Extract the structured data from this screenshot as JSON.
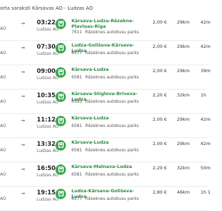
{
  "header": {
    "title": "orta saraksti Kārsavas AO - Ludzas AO"
  },
  "rows": [
    {
      "dep_time": "",
      "dep_stop": "AO",
      "arr_time": "03:22",
      "arr_stop": "Ludzas AO",
      "route": "Kārsava-Ludza-Rēzekne-Pļaviņas-Rīga",
      "route_no": "7611",
      "operator": "Rēzeknes autobusu parks",
      "price": "2,00 €",
      "distance": "29km",
      "duration": "42m"
    },
    {
      "dep_time": "",
      "dep_stop": "AO",
      "arr_time": "07:30",
      "arr_stop": "Ludzas AO",
      "route": "Ludza-Goliševa-Kārsava-Ludza",
      "route_no": "6577",
      "operator": "Rēzeknes autobusu parks",
      "price": "2,00 €",
      "distance": "29km",
      "duration": "42m"
    },
    {
      "dep_time": "",
      "dep_stop": "AO",
      "arr_time": "09:00",
      "arr_stop": "Ludzas AO",
      "route": "Kārsava-Ludza",
      "route_no": "6581",
      "operator": "Rēzeknes autobusu parks",
      "price": "2,00 €",
      "distance": "29km",
      "duration": "39m"
    },
    {
      "dep_time": "",
      "dep_stop": "AO",
      "arr_time": "10:35",
      "arr_stop": "Ludzas AO",
      "route": "Kārsava-Stiglova-Brīveva-Ludza",
      "route_no": "6593",
      "operator": "Rēzeknes autobusu parks",
      "price": "2,20 €",
      "distance": "32km",
      "duration": "1h"
    },
    {
      "dep_time": "",
      "dep_stop": "AO",
      "arr_time": "11:12",
      "arr_stop": "Ludzas AO",
      "route": "Kārsava-Ludza",
      "route_no": "6581",
      "operator": "Rēzeknes autobusu parks",
      "price": "2,00 €",
      "distance": "29km",
      "duration": "42m"
    },
    {
      "dep_time": "",
      "dep_stop": "AO",
      "arr_time": "13:32",
      "arr_stop": "Ludzas AO",
      "route": "Kārsava-Ludza",
      "route_no": "6581",
      "operator": "Rēzeknes autobusu parks",
      "price": "2,00 €",
      "distance": "29km",
      "duration": "42m"
    },
    {
      "dep_time": "",
      "dep_stop": "AO",
      "arr_time": "16:50",
      "arr_stop": "Ludzas AO",
      "route": "Kārsava-Malnava-Ludza",
      "route_no": "6581",
      "operator": "Rēzeknes autobusu parks",
      "price": "2,20 €",
      "distance": "32km",
      "duration": "50m"
    },
    {
      "dep_time": "",
      "dep_stop": "AO",
      "arr_time": "19:15",
      "arr_stop": "Ludzas AO",
      "route": "Ludza-Kārsava-Goliševa-Ludza",
      "route_no": "6577",
      "operator": "Rēzeknes autobusu parks",
      "price": "2,80 €",
      "distance": "46km",
      "duration": "1h 1"
    }
  ],
  "icons": {
    "bus": "bus-icon",
    "arrow": "arrow-right-icon"
  },
  "colors": {
    "bus_bg": "#3aa84f",
    "route_text": "#2c8c45"
  }
}
